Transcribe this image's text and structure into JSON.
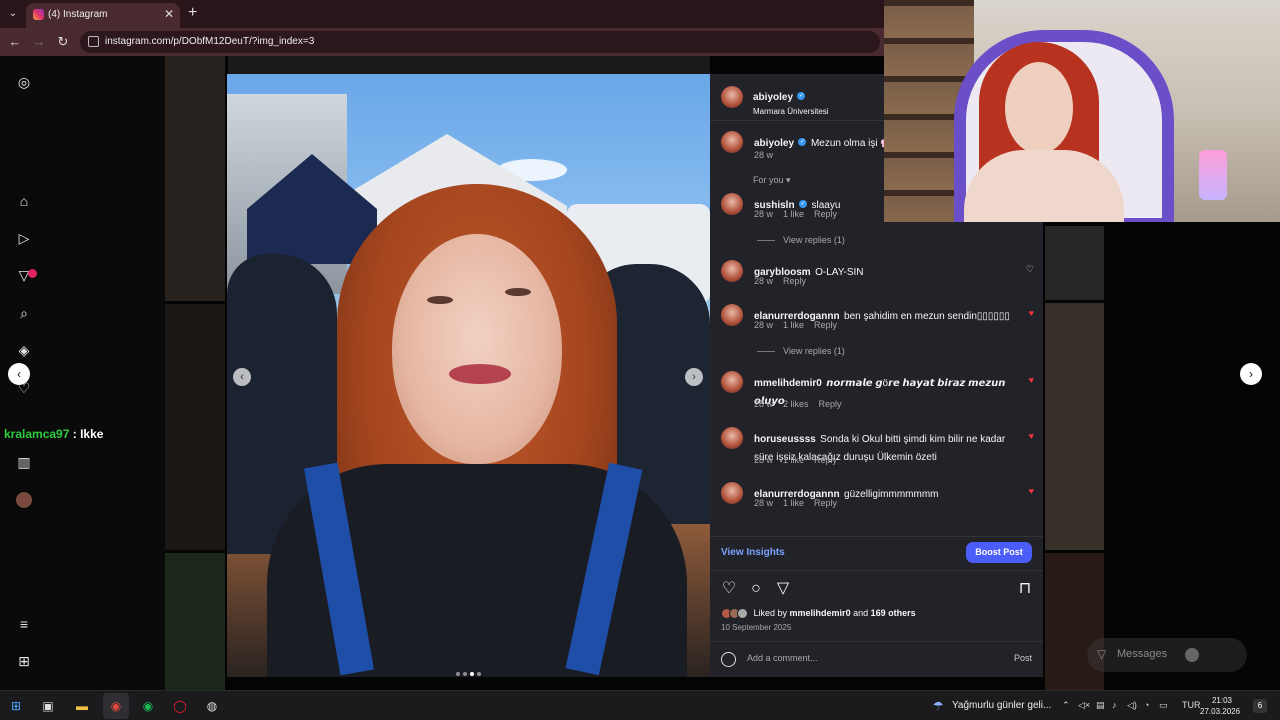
{
  "browser": {
    "tab_title": "(4) Instagram",
    "url": "instagram.com/p/DObfM12DeuT/?img_index=3",
    "tab_close": "✕",
    "new_tab": "+"
  },
  "post": {
    "author": "abiyoley",
    "location": "Marmara Üniversitesi",
    "caption": "Mezun olma işi 🌸",
    "caption_age": "28 w",
    "filter_label": "For you ▾",
    "view_insights": "View Insights",
    "boost_button": "Boost Post",
    "liked_by_prefix": "Liked by ",
    "liked_by_user": "mmelihdemir0",
    "liked_by_suffix": " and ",
    "liked_by_others": "169 others",
    "date": "10 September 2025",
    "comment_placeholder": "Add a comment...",
    "post_button": "Post",
    "image_index": 3
  },
  "comments": [
    {
      "user": "sushisln",
      "verified": true,
      "text": "slaayu",
      "age": "28 w",
      "likes": "1 like",
      "reply": "Reply",
      "liked": false,
      "view_replies": "View replies (1)"
    },
    {
      "user": "garybloosm",
      "verified": false,
      "text": "O-LAY-SIN",
      "age": "28 w",
      "likes": "",
      "reply": "Reply",
      "liked": false,
      "view_replies": ""
    },
    {
      "user": "elanurrerdogannn",
      "verified": false,
      "text": "ben şahidim en mezun sendin▯▯▯▯▯▯",
      "age": "28 w",
      "likes": "1 like",
      "reply": "Reply",
      "liked": true,
      "view_replies": "View replies (1)"
    },
    {
      "user": "mmelihdemir0",
      "verified": false,
      "text": "𝙣𝙤𝙧𝙢𝙖𝙡𝙚 𝙜ö𝙧𝙚 𝙝𝙖𝙮𝙖𝙩 𝙗𝙞𝙧𝙖𝙯 𝙢𝙚𝙯𝙪𝙣 𝙤𝙡𝙪𝙮𝙤",
      "age": "28 w",
      "likes": "2 likes",
      "reply": "Reply",
      "liked": true,
      "view_replies": ""
    },
    {
      "user": "horuseussss",
      "verified": false,
      "text": "Sonda ki Okul bitti şimdi kim bilir ne kadar süre işsiz kalacağız duruşu Ülkemin özeti",
      "age": "28 w",
      "likes": "1 like",
      "reply": "Reply",
      "liked": true,
      "view_replies": ""
    },
    {
      "user": "elanurrerdogannn",
      "verified": false,
      "text": "güzelligimmmmmmm",
      "age": "28 w",
      "likes": "1 like",
      "reply": "Reply",
      "liked": true,
      "view_replies": ""
    }
  ],
  "chat": {
    "user": "kralamca97",
    "separator": " : ",
    "message": "Ikke"
  },
  "messages_pill": "Messages",
  "taskbar": {
    "weather": "Yağmurlu günler geli...",
    "lang": "TUR",
    "time": "21:03",
    "date": "27.03.2026",
    "notif_count": "6"
  },
  "icons": {
    "like": "heart-icon",
    "comment": "comment-icon",
    "share": "share-icon",
    "save": "bookmark-icon"
  },
  "colors": {
    "accent": "#4a5df9",
    "like_red": "#ff3040",
    "chat_user": "#2ecc40"
  }
}
